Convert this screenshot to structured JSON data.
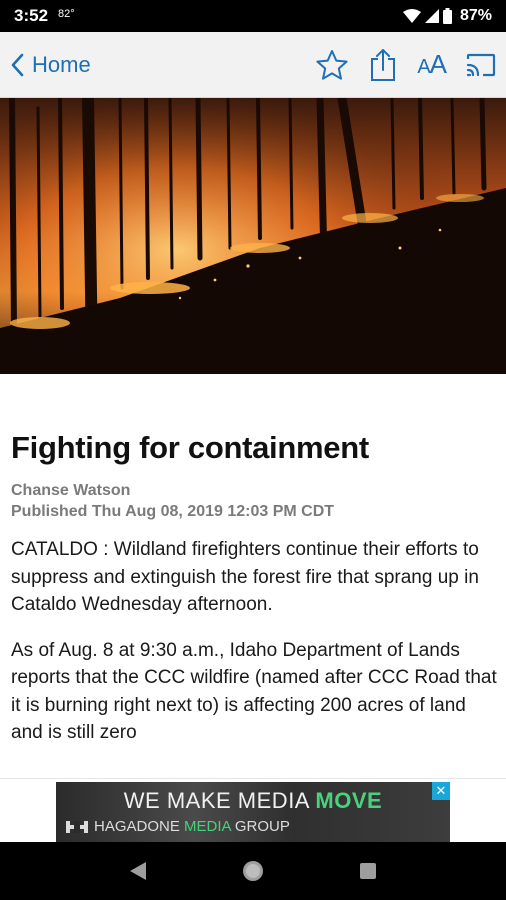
{
  "status": {
    "time": "3:52",
    "temp": "82°",
    "battery": "87%"
  },
  "header": {
    "back_label": "Home",
    "icons": [
      "chevron-left-icon",
      "star-icon",
      "share-icon",
      "text-size-icon",
      "cast-icon"
    ],
    "text_size_label_small": "A",
    "text_size_label_large": "A"
  },
  "hero": {
    "icon": "wildfire-photo"
  },
  "article": {
    "headline": "Fighting for containment",
    "author": "Chanse Watson",
    "published": "Published Thu Aug 08, 2019 12:03 PM CDT",
    "paragraphs": [
      "CATALDO : Wildland firefighters continue their efforts to suppress and extinguish the forest fire that sprang up in Cataldo Wednesday afternoon.",
      "As of Aug. 8 at 9:30 a.m., Idaho Department of Lands reports that the CCC wildfire (named after CCC Road that it is burning right next to) is affecting 200 acres of land and is still zero"
    ]
  },
  "ad": {
    "line1_prefix": "WE MAKE MEDIA ",
    "line1_accent": "MOVE",
    "line2_prefix": "HAGADONE ",
    "line2_accent": "MEDIA",
    "line2_suffix": " GROUP",
    "close_label": "✕"
  },
  "colors": {
    "accent": "#1f6fb5",
    "ad_accent": "#49d27b",
    "ad_close": "#1aa7d8"
  }
}
